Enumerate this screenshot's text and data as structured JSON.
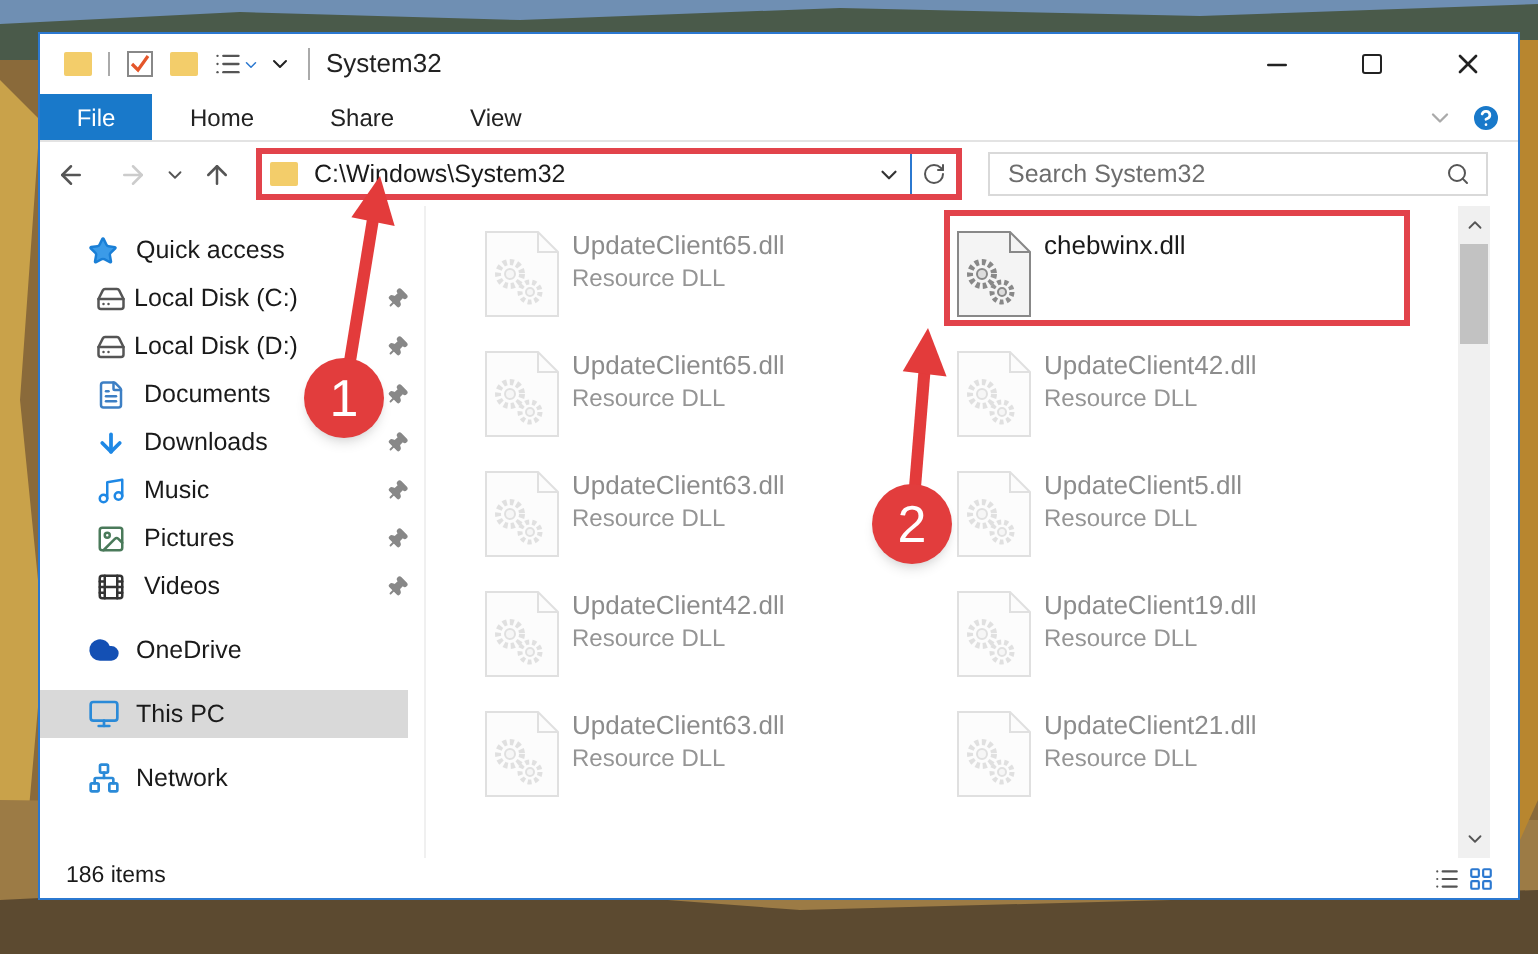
{
  "window": {
    "title": "System32"
  },
  "ribbon": {
    "tabs": [
      {
        "label": "File",
        "kind": "file_menu",
        "selected": false
      },
      {
        "label": "Home",
        "kind": "tab",
        "selected": false
      },
      {
        "label": "Share",
        "kind": "tab",
        "selected": false
      },
      {
        "label": "View",
        "kind": "tab",
        "selected": false
      }
    ]
  },
  "address_bar": {
    "path": "C:\\Windows\\System32",
    "highlighted": true
  },
  "search": {
    "placeholder": "Search System32"
  },
  "sidebar": {
    "items": [
      {
        "label": "Quick access",
        "selected": false,
        "children": [
          {
            "label": "Local Disk (C:)",
            "pinned": true,
            "selected": false
          },
          {
            "label": "Local Disk (D:)",
            "pinned": true,
            "selected": false
          },
          {
            "label": "Documents",
            "pinned": true,
            "selected": false
          },
          {
            "label": "Downloads",
            "pinned": true,
            "selected": false
          },
          {
            "label": "Music",
            "pinned": true,
            "selected": false
          },
          {
            "label": "Pictures",
            "pinned": true,
            "selected": false
          },
          {
            "label": "Videos",
            "pinned": true,
            "selected": false
          }
        ]
      },
      {
        "label": "OneDrive",
        "selected": false
      },
      {
        "label": "This PC",
        "selected": true
      },
      {
        "label": "Network",
        "selected": false
      }
    ]
  },
  "files": [
    {
      "name": "UpdateClient65.dll",
      "type": "Resource DLL",
      "blurred": true
    },
    {
      "name": "chebwinx.dll",
      "blurred": false,
      "highlighted": true
    },
    {
      "name": "UpdateClient65.dll",
      "type": "Resource DLL",
      "blurred": true
    },
    {
      "name": "UpdateClient42.dll",
      "type": "Resource DLL",
      "blurred": true
    },
    {
      "name": "UpdateClient63.dll",
      "type": "Resource DLL",
      "blurred": true
    },
    {
      "name": "UpdateClient5.dll",
      "type": "Resource DLL",
      "blurred": true
    },
    {
      "name": "UpdateClient42.dll",
      "type": "Resource DLL",
      "blurred": true
    },
    {
      "name": "UpdateClient19.dll",
      "type": "Resource DLL",
      "blurred": true
    },
    {
      "name": "UpdateClient63.dll",
      "type": "Resource DLL",
      "blurred": true
    },
    {
      "name": "UpdateClient21.dll",
      "type": "Resource DLL",
      "blurred": true
    }
  ],
  "status_bar": {
    "count": "186 items"
  },
  "annotations": [
    {
      "label": "1"
    },
    {
      "label": "2"
    }
  ]
}
